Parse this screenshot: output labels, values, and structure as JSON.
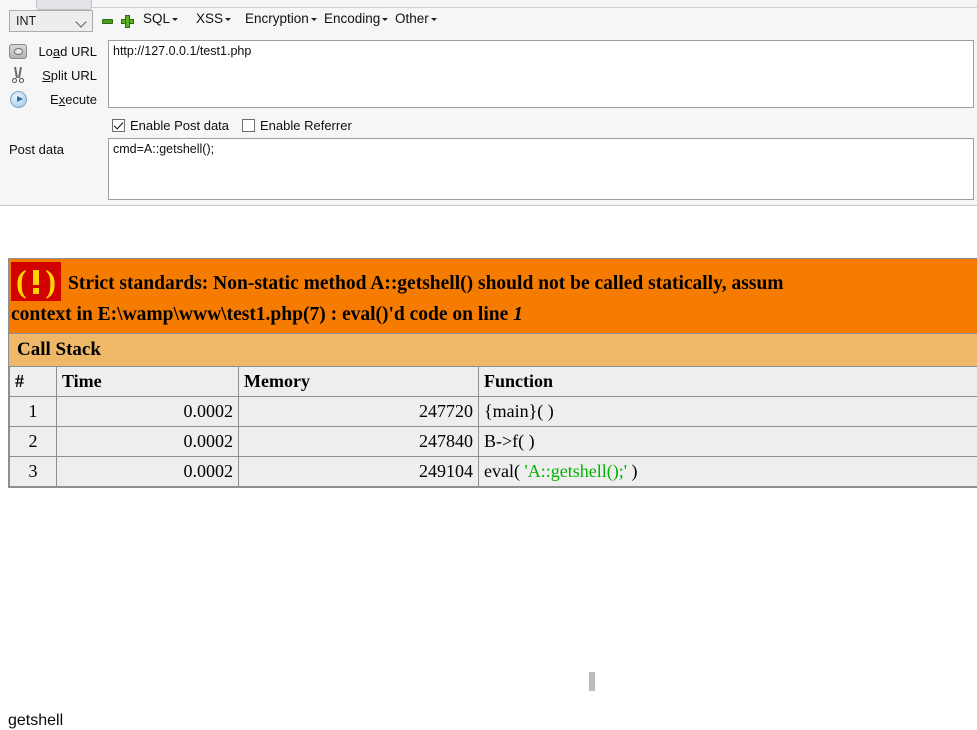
{
  "toolbar": {
    "type_select": {
      "value": "INT",
      "caret_icon": "chevron-down-icon"
    },
    "remove_label": "",
    "add_label": "",
    "menus": [
      {
        "label": "SQL"
      },
      {
        "label": "XSS"
      },
      {
        "label": "Encryption"
      },
      {
        "label": "Encoding"
      },
      {
        "label": "Other"
      }
    ],
    "actions": [
      {
        "icon": "load-url-icon",
        "label_pre": "Lo",
        "label_key": "a",
        "label_post": "d URL"
      },
      {
        "icon": "split-url-icon",
        "label_pre": "",
        "label_key": "S",
        "label_post": "plit URL"
      },
      {
        "icon": "execute-icon",
        "label_pre": "E",
        "label_key": "x",
        "label_post": "ecute"
      }
    ],
    "url": {
      "value": "http://127.0.0.1/test1.php",
      "placeholder": ""
    },
    "checkboxes": [
      {
        "label": "Enable Post data",
        "checked": true
      },
      {
        "label": "Enable Referrer",
        "checked": false
      }
    ],
    "post_data_label": "Post data",
    "post_data": {
      "value": "cmd=A::getshell();",
      "placeholder": ""
    }
  },
  "xdebug": {
    "icon_name": "warning-exclamation-icon",
    "message_line1": "Strict standards: Non-static method A::getshell() should not be called statically, assum",
    "message_line2_pre": "context in E:\\wamp\\www\\test1.php(7) : eval()'d code on line ",
    "message_line2_em": "1",
    "callstack_title": "Call Stack",
    "columns": [
      "#",
      "Time",
      "Memory",
      "Function"
    ],
    "rows": [
      {
        "num": "1",
        "time": "0.0002",
        "memory": "247720",
        "function": "{main}( )",
        "fn_pre": "{main}( )",
        "fn_str": "",
        "fn_post": ""
      },
      {
        "num": "2",
        "time": "0.0002",
        "memory": "247840",
        "function": "B->f( )",
        "fn_pre": "B->f( )",
        "fn_str": "",
        "fn_post": ""
      },
      {
        "num": "3",
        "time": "0.0002",
        "memory": "249104",
        "function": "eval( 'A::getshell();' )",
        "fn_pre": "eval( ",
        "fn_str": "'A::getshell();'",
        "fn_post": " )"
      }
    ],
    "colors": {
      "banner_bg": "#f57c00",
      "callstack_bg": "#eeb868",
      "icon_bg": "#d30000",
      "icon_fg": "#ffd400",
      "string_green": "#00b000"
    }
  },
  "output": {
    "echo_text": "getshell"
  }
}
